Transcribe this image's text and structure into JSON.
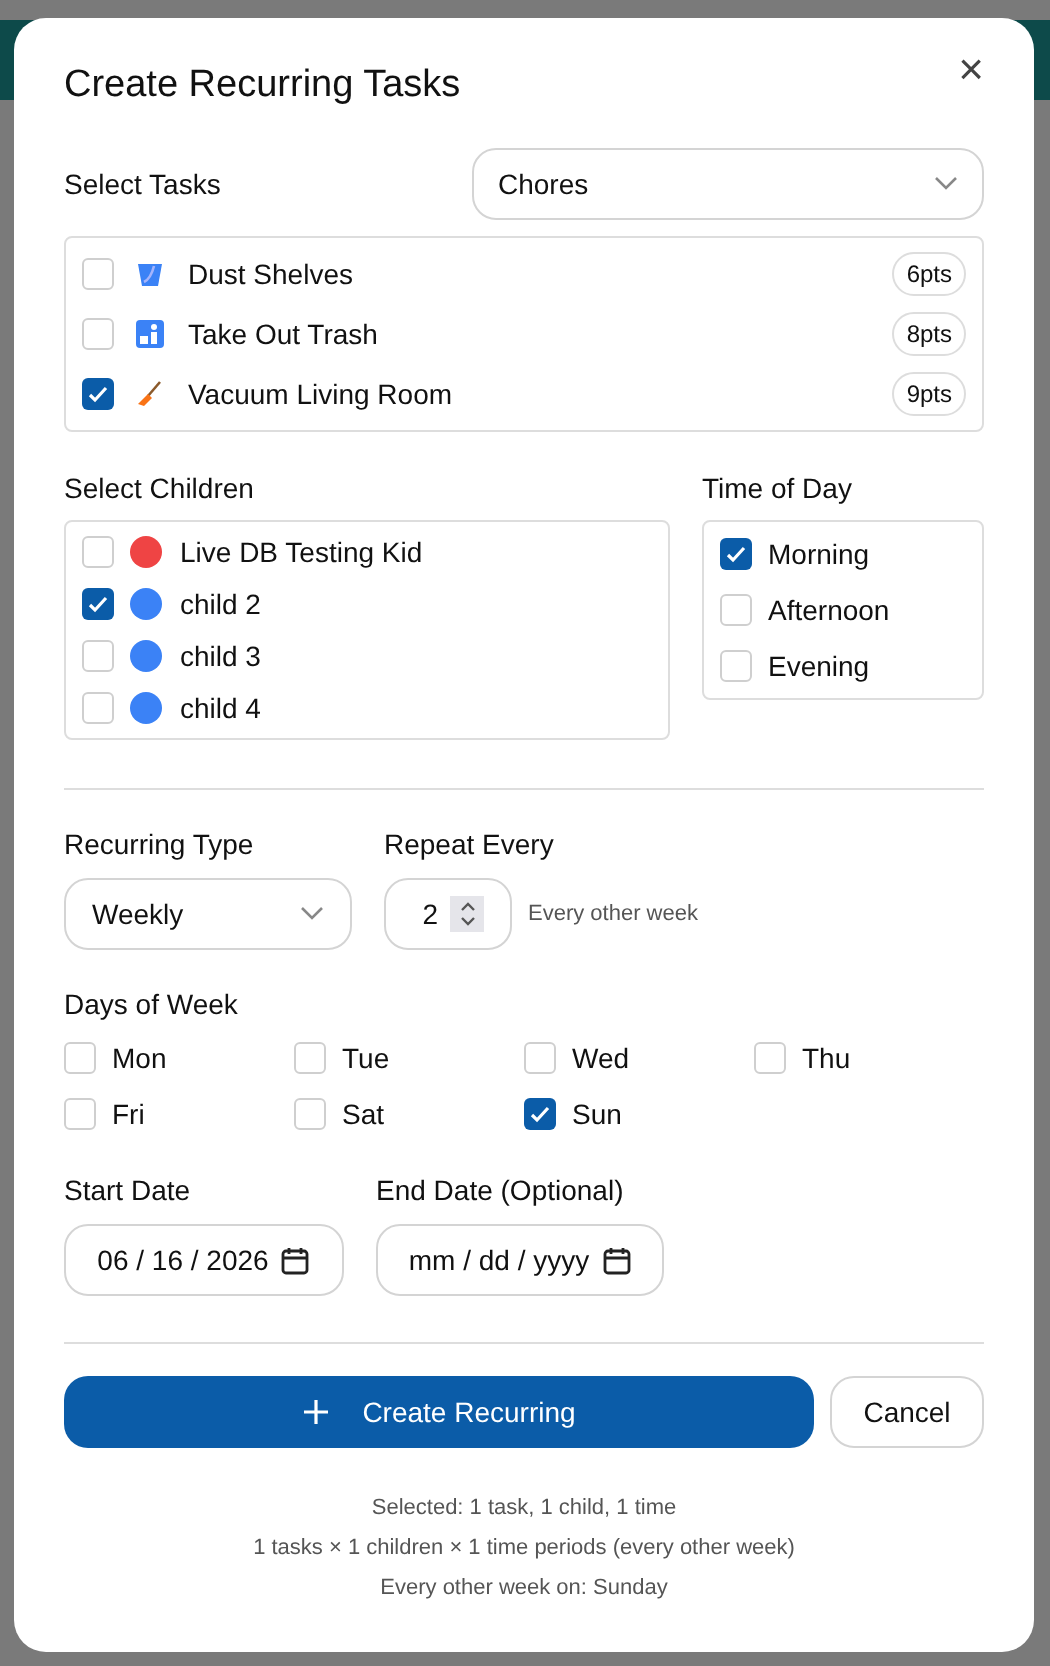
{
  "dialog": {
    "title": "Create Recurring Tasks",
    "close": "×"
  },
  "tasks": {
    "label": "Select Tasks",
    "category": "Chores",
    "items": [
      {
        "name": "Dust Shelves",
        "points": "6pts",
        "checked": false
      },
      {
        "name": "Take Out Trash",
        "points": "8pts",
        "checked": false
      },
      {
        "name": "Vacuum Living Room",
        "points": "9pts",
        "checked": true
      }
    ]
  },
  "children": {
    "label": "Select Children",
    "items": [
      {
        "name": "Live DB Testing Kid",
        "color": "#ef4444",
        "checked": false
      },
      {
        "name": "child 2",
        "color": "#3b82f6",
        "checked": true
      },
      {
        "name": "child 3",
        "color": "#3b82f6",
        "checked": false
      },
      {
        "name": "child 4",
        "color": "#3b82f6",
        "checked": false
      }
    ]
  },
  "time_of_day": {
    "label": "Time of Day",
    "items": [
      {
        "name": "Morning",
        "checked": true
      },
      {
        "name": "Afternoon",
        "checked": false
      },
      {
        "name": "Evening",
        "checked": false
      }
    ]
  },
  "recurring_type": {
    "label": "Recurring Type",
    "value": "Weekly"
  },
  "repeat_every": {
    "label": "Repeat Every",
    "value": "2",
    "hint": "Every other week"
  },
  "days_of_week": {
    "label": "Days of Week",
    "items": [
      {
        "name": "Mon",
        "checked": false
      },
      {
        "name": "Tue",
        "checked": false
      },
      {
        "name": "Wed",
        "checked": false
      },
      {
        "name": "Thu",
        "checked": false
      },
      {
        "name": "Fri",
        "checked": false
      },
      {
        "name": "Sat",
        "checked": false
      },
      {
        "name": "Sun",
        "checked": true
      }
    ]
  },
  "start_date": {
    "label": "Start Date",
    "value": "06 / 16 / 2026"
  },
  "end_date": {
    "label": "End Date (Optional)",
    "placeholder": "mm / dd / yyyy"
  },
  "buttons": {
    "create": "Create Recurring",
    "cancel": "Cancel"
  },
  "summary": [
    "Selected: 1 task, 1 child, 1 time",
    "1 tasks × 1 children × 1 time periods (every other week)",
    "Every other week on: Sunday"
  ]
}
